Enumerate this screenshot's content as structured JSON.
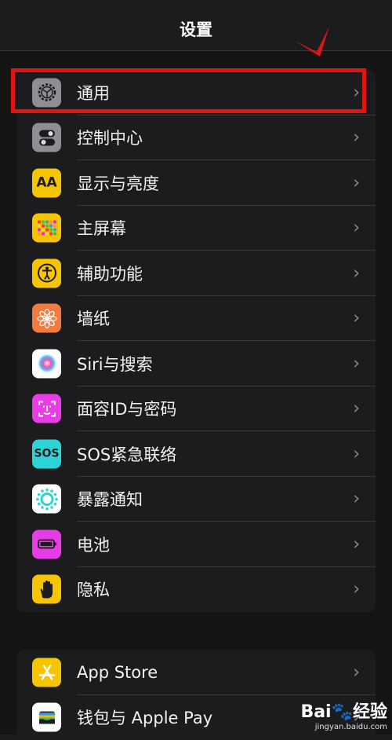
{
  "nav": {
    "title": "设置"
  },
  "group1": [
    {
      "name": "general",
      "label": "通用",
      "icon": "gear-icon",
      "color": "#8e8e93"
    },
    {
      "name": "control-center",
      "label": "控制中心",
      "icon": "toggle-icon",
      "color": "#8e8e93"
    },
    {
      "name": "display",
      "label": "显示与亮度",
      "icon": "text-size-icon",
      "text": "AA",
      "color": "#f6c500"
    },
    {
      "name": "home-screen",
      "label": "主屏幕",
      "icon": "app-grid-icon",
      "color": "#f6c500"
    },
    {
      "name": "accessibility",
      "label": "辅助功能",
      "icon": "accessibility-icon",
      "color": "#f6c500"
    },
    {
      "name": "wallpaper",
      "label": "墙纸",
      "icon": "flower-icon",
      "color": "#f27b3d"
    },
    {
      "name": "siri",
      "label": "Siri与搜索",
      "icon": "siri-icon",
      "color": "#ffffff"
    },
    {
      "name": "face-id",
      "label": "面容ID与密码",
      "icon": "face-id-icon",
      "color": "#e83ce6"
    },
    {
      "name": "sos",
      "label": "SOS紧急联络",
      "icon": "sos-icon",
      "text": "SOS",
      "color": "#2dd4d6"
    },
    {
      "name": "exposure",
      "label": "暴露通知",
      "icon": "exposure-icon",
      "color": "#ffffff"
    },
    {
      "name": "battery",
      "label": "电池",
      "icon": "battery-icon",
      "color": "#e83ce6"
    },
    {
      "name": "privacy",
      "label": "隐私",
      "icon": "hand-icon",
      "color": "#f6c500"
    }
  ],
  "group2": [
    {
      "name": "app-store",
      "label": "App Store",
      "icon": "app-store-icon",
      "color": "#f6c500"
    },
    {
      "name": "wallet",
      "label": "钱包与 Apple Pay",
      "icon": "wallet-icon",
      "color": "#ffffff"
    }
  ],
  "chevron": "›",
  "watermark": {
    "logo": "Bai🐾经验",
    "sub": "jingyan.baidu.com"
  }
}
